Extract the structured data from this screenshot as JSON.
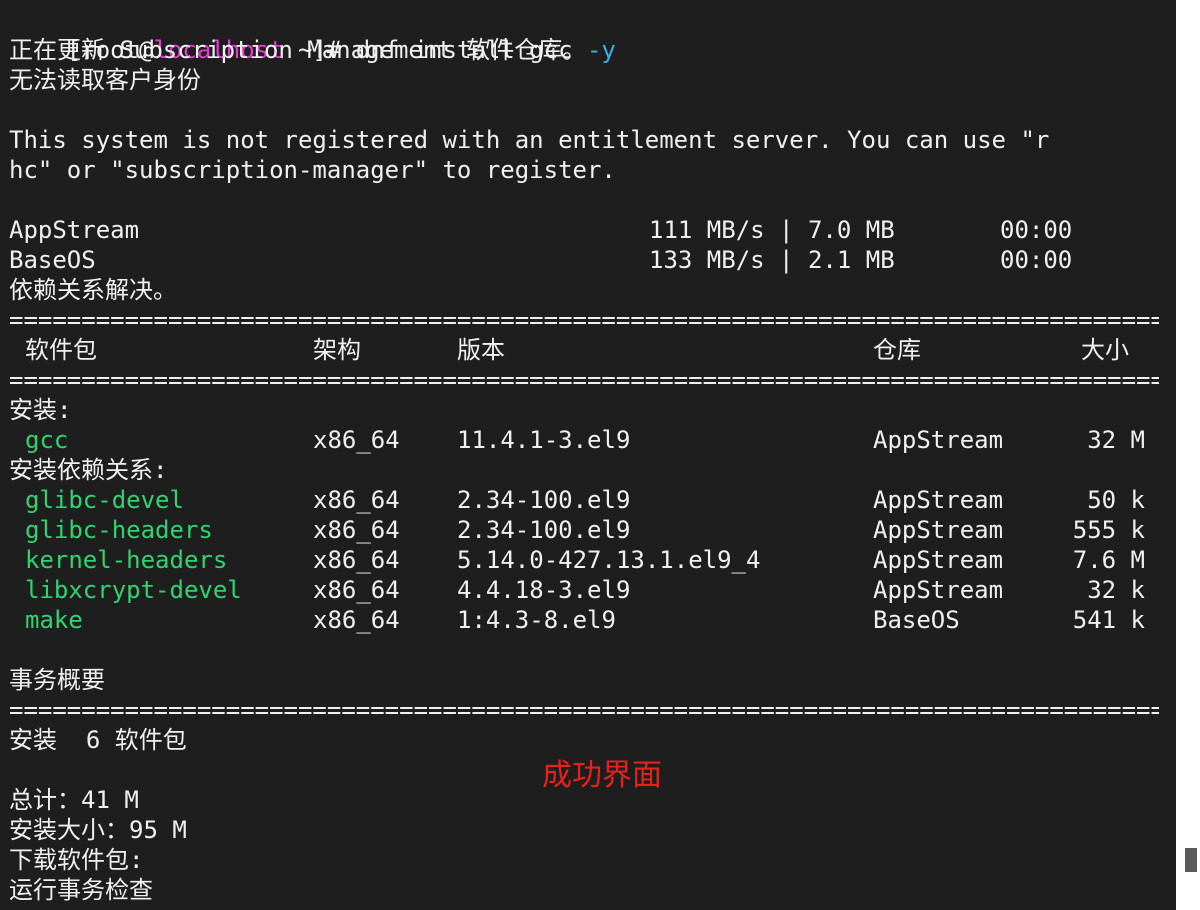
{
  "colors": {
    "background": "#1e1e1e",
    "text": "#f0f0f0",
    "hostname": "#e33ad8",
    "flag": "#3ab0e8",
    "package_name": "#2fd470",
    "annotation": "#e8221b"
  },
  "prompt": {
    "prefix": "[root@",
    "hostname": "localhost",
    "suffix": " ~]# ",
    "command": "dnf install gcc ",
    "flag": "-y"
  },
  "messages": {
    "updating_repos": "正在更新 Subscription Management 软件仓库。",
    "cannot_read_identity": "无法读取客户身份",
    "not_registered_line1": "This system is not registered with an entitlement server. You can use \"r",
    "not_registered_line2": "hc\" or \"subscription-manager\" to register."
  },
  "repos": [
    {
      "name": "AppStream",
      "speed": "111 MB/s | 7.0 MB",
      "time": "00:00"
    },
    {
      "name": "BaseOS",
      "speed": "133 MB/s | 2.1 MB",
      "time": "00:00"
    }
  ],
  "dependencies_resolved": "依赖关系解决。",
  "separator": "================================================================================",
  "table": {
    "headers": {
      "package": "软件包",
      "arch": "架构",
      "version": "版本",
      "repository": "仓库",
      "size": "大小"
    },
    "installing_label": "安装:",
    "installing": [
      {
        "name": "gcc",
        "arch": "x86_64",
        "version": "11.4.1-3.el9",
        "repo": "AppStream",
        "size": "32 M"
      }
    ],
    "deps_label": "安装依赖关系:",
    "dependencies": [
      {
        "name": "glibc-devel",
        "arch": "x86_64",
        "version": "2.34-100.el9",
        "repo": "AppStream",
        "size": "50 k"
      },
      {
        "name": "glibc-headers",
        "arch": "x86_64",
        "version": "2.34-100.el9",
        "repo": "AppStream",
        "size": "555 k"
      },
      {
        "name": "kernel-headers",
        "arch": "x86_64",
        "version": "5.14.0-427.13.1.el9_4",
        "repo": "AppStream",
        "size": "7.6 M"
      },
      {
        "name": "libxcrypt-devel",
        "arch": "x86_64",
        "version": "4.4.18-3.el9",
        "repo": "AppStream",
        "size": "32 k"
      },
      {
        "name": "make",
        "arch": "x86_64",
        "version": "1:4.3-8.el9",
        "repo": "BaseOS",
        "size": "541 k"
      }
    ]
  },
  "summary": {
    "title": "事务概要",
    "install_count": "安装  6 软件包",
    "total": "总计：41 M",
    "installed_size": "安装大小：95 M",
    "downloading": "下载软件包:",
    "running_check": "运行事务检查"
  },
  "annotation": "成功界面"
}
